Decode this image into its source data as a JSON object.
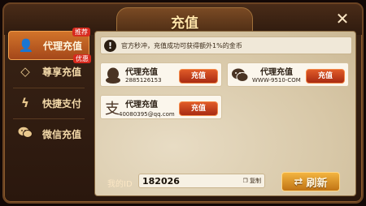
{
  "dialog": {
    "title": "充值"
  },
  "sidebar": {
    "items": [
      {
        "label": "代理充值",
        "icon": "person-icon",
        "badge": "推荐",
        "active": true
      },
      {
        "label": "尊享充值",
        "icon": "diamond-icon",
        "badge": "优惠",
        "active": false
      },
      {
        "label": "快捷支付",
        "icon": "lightning-icon",
        "badge": "",
        "active": false
      },
      {
        "label": "微信充值",
        "icon": "wechat-icon",
        "badge": "",
        "active": false
      }
    ]
  },
  "notice": {
    "text": "官方秒冲，充值成功可获得额外1%的金币",
    "icon": "!"
  },
  "cards": [
    {
      "name": "代理充值",
      "account": "2885126153",
      "button": "充值",
      "logo": "qq-icon"
    },
    {
      "name": "代理充值",
      "account": "WWW-9510-COM",
      "button": "充值",
      "logo": "wechat-icon"
    },
    {
      "name": "代理充值",
      "account": "40080395@qq.com",
      "button": "充值",
      "logo": "alipay-icon"
    }
  ],
  "footer": {
    "id_label": "我的ID",
    "id_value": "182026",
    "copy_label": "复制",
    "refresh_label": "刷新"
  }
}
